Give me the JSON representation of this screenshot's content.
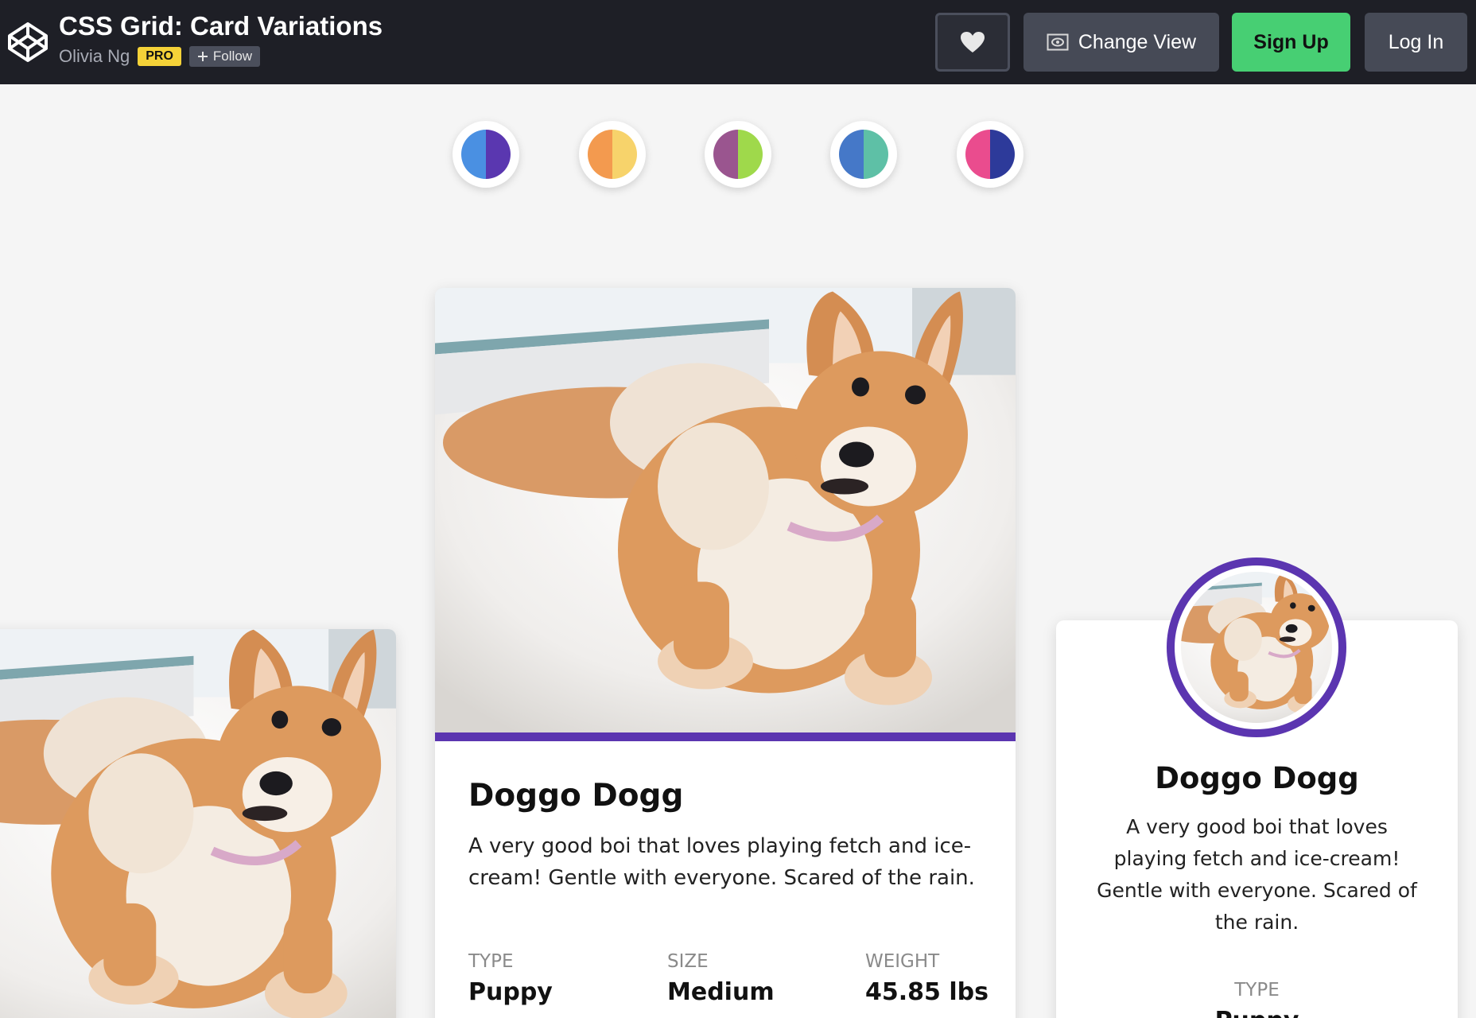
{
  "header": {
    "title": "CSS Grid: Card Variations",
    "author": "Olivia Ng",
    "pro_badge": "PRO",
    "follow_label": "Follow",
    "follow_icon": "plus-icon",
    "heart_icon": "heart-icon",
    "change_view_label": "Change View",
    "change_view_icon": "eye-icon",
    "signup_label": "Sign Up",
    "login_label": "Log In",
    "colors": {
      "bar": "#1e1f26",
      "signup": "#47cf73",
      "pro": "#f5d238"
    }
  },
  "swatches": [
    {
      "name": "swatch-blue-purple",
      "left": "#4a90e2",
      "right": "#5a37b0"
    },
    {
      "name": "swatch-orange-yellow",
      "left": "#f39a4f",
      "right": "#f7d36b"
    },
    {
      "name": "swatch-purple-green",
      "left": "#9a558f",
      "right": "#9fd94b"
    },
    {
      "name": "swatch-blue-teal",
      "left": "#4578c8",
      "right": "#5ec0a6"
    },
    {
      "name": "swatch-pink-indigo",
      "left": "#ea4c8e",
      "right": "#2d3a9a"
    }
  ],
  "cards": {
    "accent": "#5b35b0",
    "main": {
      "name": "Doggo Dogg",
      "description": "A very good boi that loves playing fetch and ice-cream! Gentle with everyone. Scared of the rain.",
      "stats": [
        {
          "label": "TYPE",
          "value": "Puppy"
        },
        {
          "label": "SIZE",
          "value": "Medium"
        },
        {
          "label": "WEIGHT",
          "value": "45.85 lbs"
        }
      ]
    },
    "right": {
      "name": "Doggo Dogg",
      "description": "A very good boi that loves playing fetch and ice-cream! Gentle with everyone. Scared of the rain.",
      "stat_label": "TYPE",
      "stat_value": "Puppy"
    }
  }
}
